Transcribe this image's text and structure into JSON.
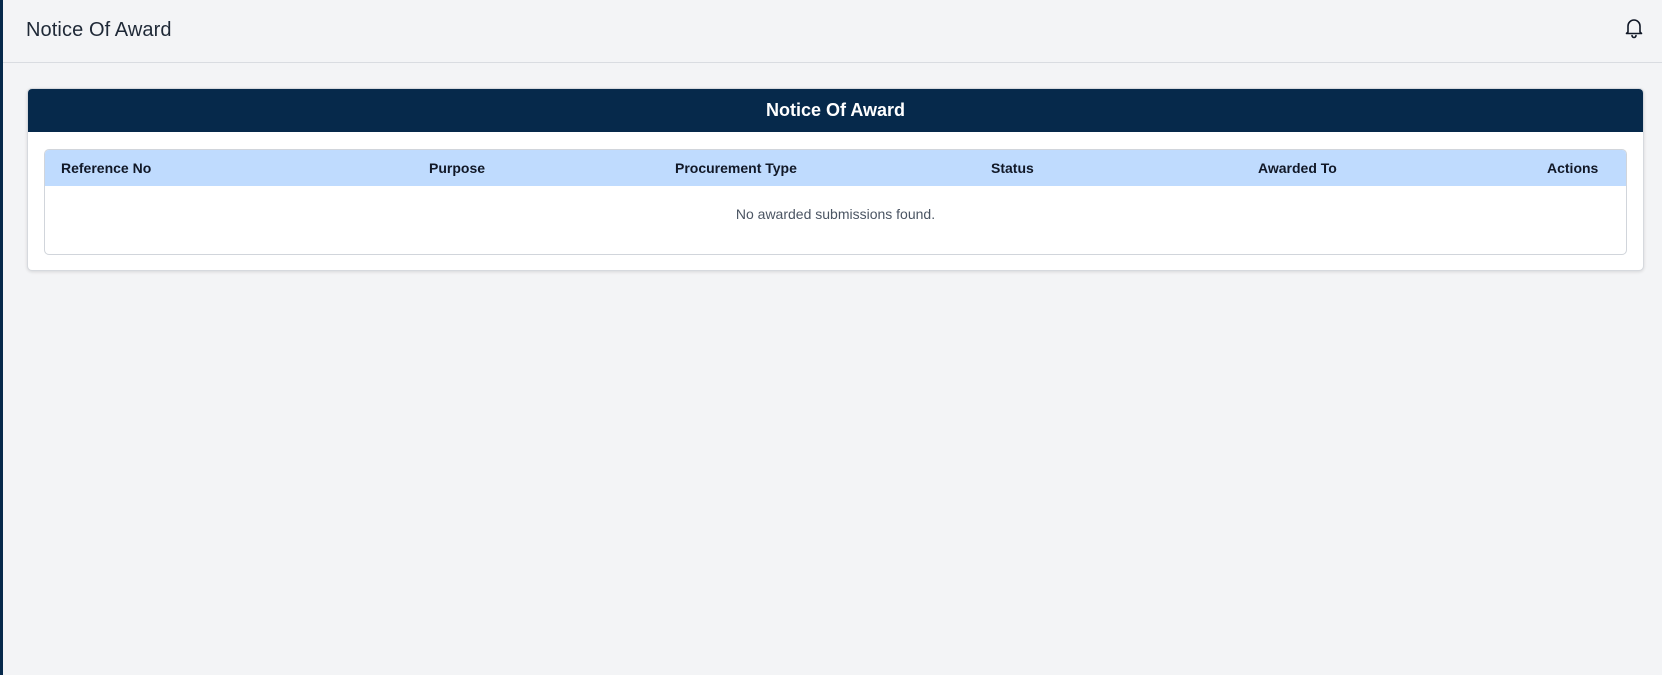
{
  "header": {
    "title": "Notice Of Award",
    "notification_icon": "bell-icon"
  },
  "card": {
    "title": "Notice Of Award"
  },
  "table": {
    "columns": [
      "Reference No",
      "Purpose",
      "Procurement Type",
      "Status",
      "Awarded To",
      "Actions"
    ],
    "rows": [],
    "empty_message": "No awarded submissions found."
  },
  "colors": {
    "accent": "#06294b",
    "table_header_bg": "#bfdbfe",
    "page_bg": "#f3f4f6"
  }
}
